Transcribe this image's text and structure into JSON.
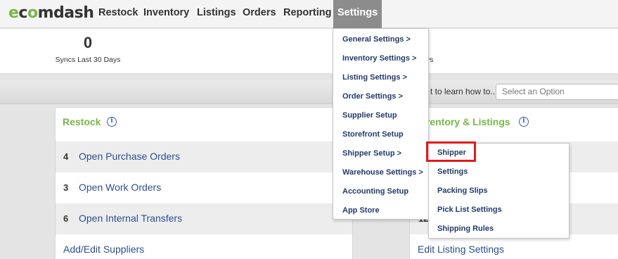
{
  "brand": {
    "logo_text": "ecomdash",
    "accent": "#7ab648",
    "highlight": "#e01b1b"
  },
  "nav": {
    "restock": "Restock",
    "inventory": "Inventory",
    "listings": "Listings",
    "orders": "Orders",
    "reporting": "Reporting",
    "settings": "Settings"
  },
  "stats": {
    "syncs_value": "0",
    "syncs_label": "Syncs Last 30 Days",
    "second_label_tail": "ys"
  },
  "help": {
    "text": "t to learn how to...",
    "select_placeholder": "Select an Option"
  },
  "restock_panel": {
    "title": "Restock",
    "rows": [
      {
        "count": "4",
        "label": "Open Purchase Orders"
      },
      {
        "count": "3",
        "label": "Open Work Orders"
      },
      {
        "count": "6",
        "label": "Open Internal Transfers"
      }
    ],
    "link": "Add/Edit Suppliers"
  },
  "inventory_panel": {
    "title": "nventory & Listings",
    "partial_count": "12",
    "link": "Edit Listing Settings"
  },
  "settings_menu": [
    "General Settings >",
    "Inventory Settings >",
    "Listing Settings >",
    "Order Settings >",
    "Supplier Setup",
    "Storefront Setup",
    "Shipper Setup >",
    "Warehouse Settings >",
    "Accounting Setup",
    "App Store"
  ],
  "shipper_submenu": [
    "Shipper",
    "Settings",
    "Packing Slips",
    "Pick List Settings",
    "Shipping Rules"
  ],
  "icons": {
    "info": "info-icon"
  }
}
